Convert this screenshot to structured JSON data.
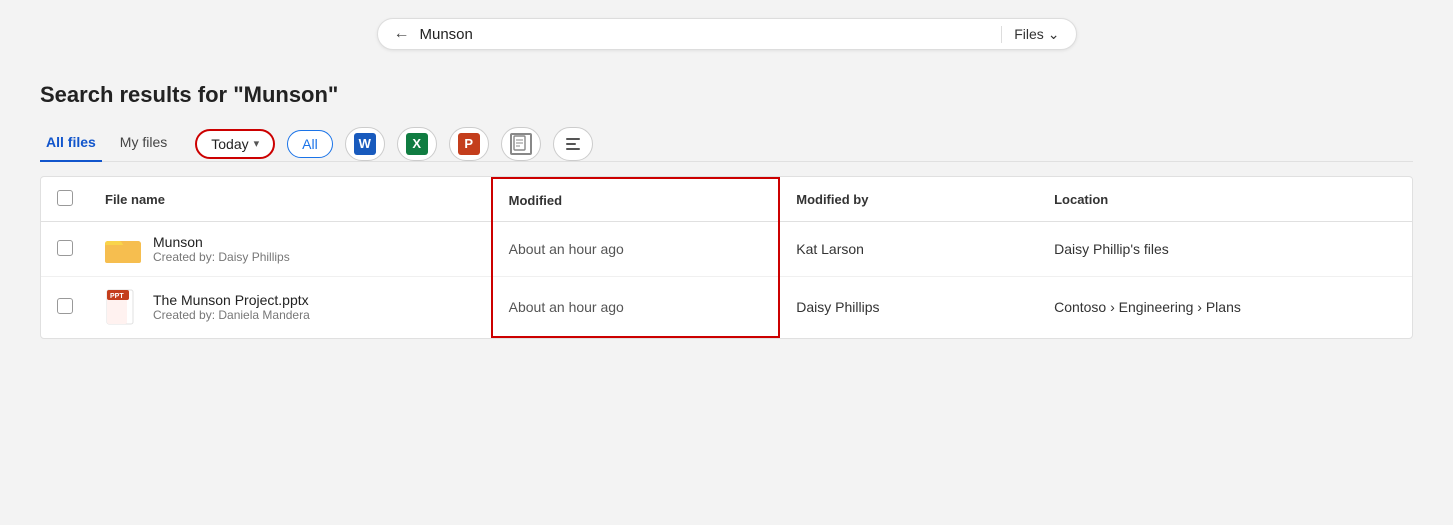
{
  "search": {
    "query": "Munson",
    "filter_label": "Files",
    "back_aria": "Back"
  },
  "heading": "Search results for \"Munson\"",
  "tabs": [
    {
      "id": "all-files",
      "label": "All files",
      "active": true
    },
    {
      "id": "my-files",
      "label": "My files",
      "active": false
    }
  ],
  "filters": {
    "date_filter": "Today",
    "date_chevron": "▾",
    "all_label": "All",
    "word_label": "W",
    "excel_label": "X",
    "ppt_label": "P",
    "pdf_label": "PDF",
    "more_label": "≡"
  },
  "table": {
    "columns": {
      "checkbox": "",
      "filename": "File name",
      "modified": "Modified",
      "modified_by": "Modified by",
      "location": "Location"
    },
    "rows": [
      {
        "id": "row-1",
        "file_type": "folder",
        "name": "Munson",
        "created_by": "Created by: Daisy Phillips",
        "modified": "About an hour ago",
        "modified_by": "Kat Larson",
        "location": "Daisy Phillip's files"
      },
      {
        "id": "row-2",
        "file_type": "pptx",
        "name": "The Munson Project.pptx",
        "created_by": "Created by: Daniela Mandera",
        "modified": "About an hour ago",
        "modified_by": "Daisy Phillips",
        "location": "Contoso › Engineering › Plans"
      }
    ]
  }
}
